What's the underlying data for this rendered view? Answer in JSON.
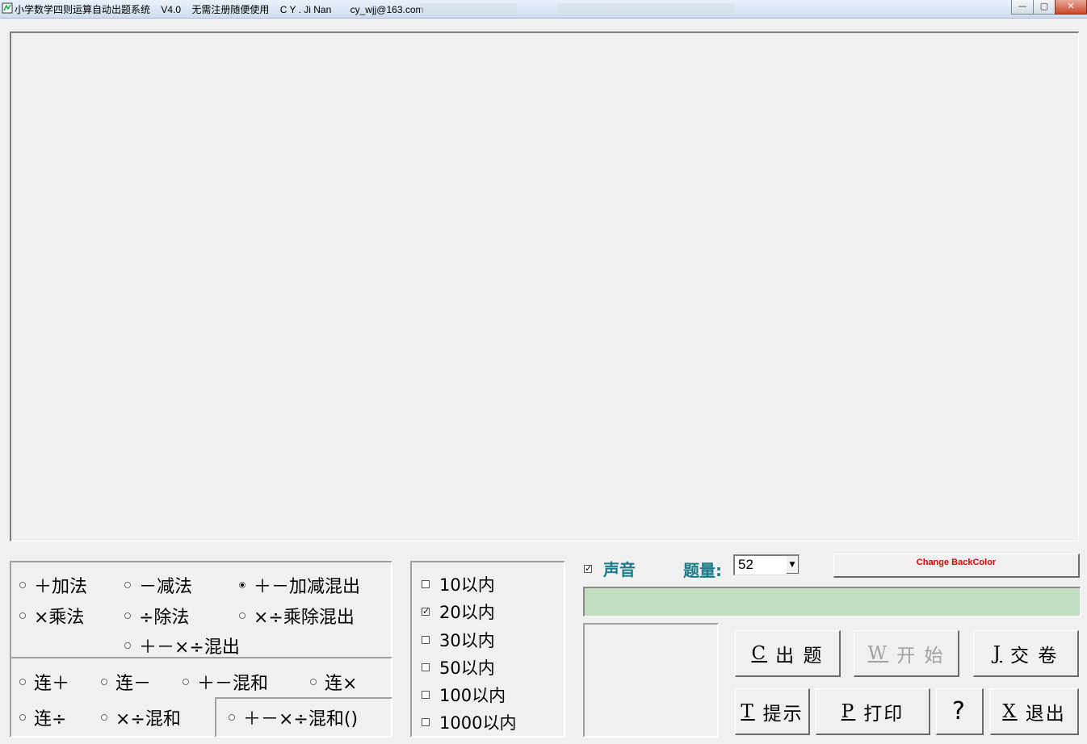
{
  "window": {
    "title": "小学数学四则运算自动出题系统    V4.0    无需注册随便使用    C Y . Ji Nan       cy_wjj@163.com"
  },
  "operations": {
    "add": "＋加法",
    "sub": "－减法",
    "add_sub_mix": "＋－加减混出",
    "mul": "×乘法",
    "div": "÷除法",
    "mul_div_mix": "×÷乘除混出",
    "all_mix": "＋－×÷混出",
    "chain_add": "连＋",
    "chain_sub": "连－",
    "add_sub_combo": "＋－混和",
    "chain_mul": "连×",
    "chain_div": "连÷",
    "mul_div_combo": "×÷混和",
    "all_combo_paren": "＋－×÷混和()",
    "selected": "add_sub_mix"
  },
  "ranges": [
    {
      "label": "10以内",
      "checked": false
    },
    {
      "label": "20以内",
      "checked": true
    },
    {
      "label": "30以内",
      "checked": false
    },
    {
      "label": "50以内",
      "checked": false
    },
    {
      "label": "100以内",
      "checked": false
    },
    {
      "label": "1000以内",
      "checked": false
    }
  ],
  "controls": {
    "sound_label": "声音",
    "sound_checked": true,
    "count_label": "题量:",
    "count_value": "52",
    "change_bg_label": "Change BackColor",
    "progress_value": ""
  },
  "buttons": {
    "generate_key": "C",
    "generate_label": "出 题",
    "start_key": "W",
    "start_label": "开 始",
    "submit_key": "J",
    "submit_label": "交 卷",
    "hint_key": "T",
    "hint_label": "提示",
    "print_key": "P",
    "print_label": "打印",
    "help_label": "?",
    "exit_key": "X",
    "exit_label": "退出"
  },
  "colors": {
    "accent_teal": "#1a7a8a",
    "progress_bg": "#c2ddc0",
    "change_bg_text": "#e00000"
  }
}
